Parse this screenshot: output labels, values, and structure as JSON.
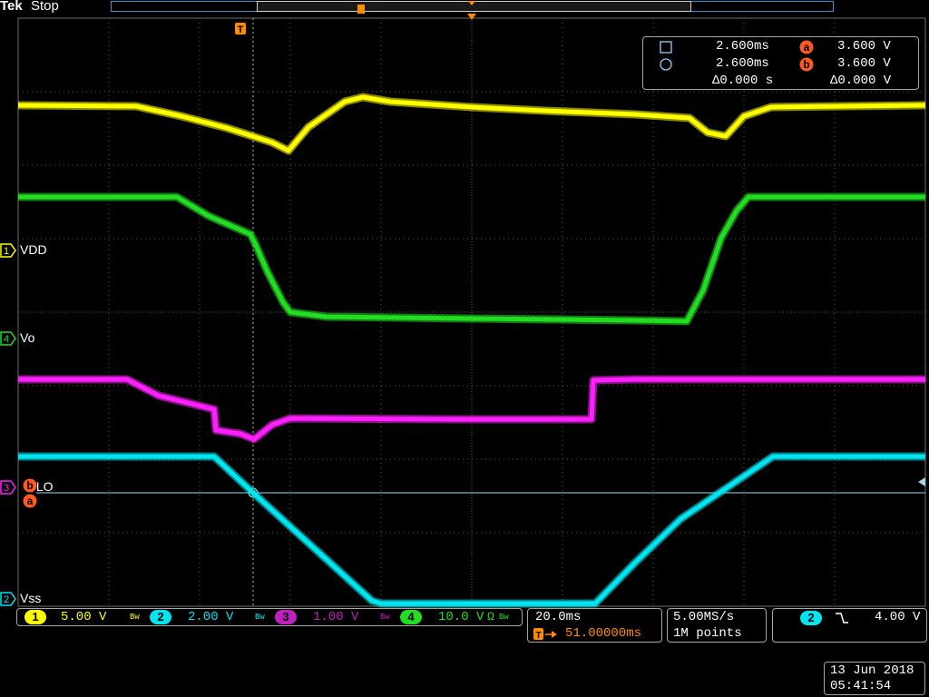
{
  "app": {
    "brand": "Tek",
    "run_state": "Stop"
  },
  "colors": {
    "ch1": "#ffff00",
    "ch2": "#00e5f0",
    "ch3": "#ff20ff",
    "ch4": "#22dd22",
    "cursor_marker": "#ff5a1f",
    "trigger_marker": "#ff8c00",
    "grid": "#5a5a5a"
  },
  "cursor_readout": {
    "square_time": "2.600ms",
    "circle_time": "2.600ms",
    "delta_time": "Δ0.000 s",
    "a_value": "3.600 V",
    "b_value": "3.600 V",
    "delta_value": "Δ0.000 V",
    "a_marker": "a",
    "b_marker": "b"
  },
  "channels": [
    {
      "number": "1",
      "name": "VDD",
      "scale": "5.00 V",
      "bw": "Bw"
    },
    {
      "number": "2",
      "name": "Vss",
      "scale": "2.00 V",
      "bw": "Bw"
    },
    {
      "number": "3",
      "name": "UVLO",
      "scale": "1.00 V",
      "bw": "Bw"
    },
    {
      "number": "4",
      "name": "Vo",
      "scale": "10.0 V",
      "bw": "Ω",
      "extra": "Bw"
    }
  ],
  "ch3_label_visible": "/LO",
  "trigger_marker_label": "T",
  "timebase": {
    "scale": "20.0ms",
    "delay": "51.00000ms"
  },
  "acquisition": {
    "sample_rate": "5.00MS/s",
    "record_length": "1M points"
  },
  "trigger": {
    "source": "2",
    "slope_icon": "falling-edge-icon",
    "level": "4.00 V"
  },
  "datetime": {
    "date": "13 Jun 2018",
    "time": "05:41:54"
  }
}
